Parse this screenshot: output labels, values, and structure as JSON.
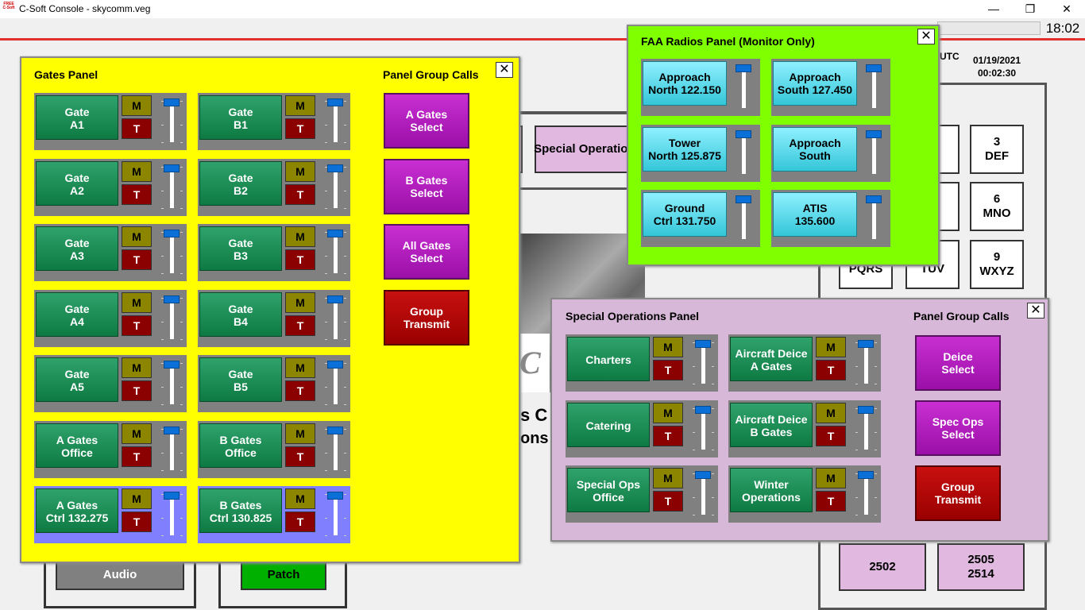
{
  "window": {
    "title": "C-Soft Console - skycomm.veg",
    "icon_text": "FREE C-Soft",
    "minimize": "—",
    "maximize": "❐",
    "close": "✕"
  },
  "clock": "18:02",
  "utc": {
    "label": "UTC",
    "date": "01/19/2021",
    "time": "00:02:30"
  },
  "background": {
    "special_operations": "Special Operations",
    "keypad": [
      {
        "label": "3\nDEF"
      },
      {
        "label": "6\nMNO"
      },
      {
        "label": "9\nWXYZ"
      },
      {
        "label": "PQRS"
      },
      {
        "label": "TUV"
      }
    ],
    "bottom_buttons": [
      {
        "label": "2502"
      },
      {
        "label": "2505\n2514"
      }
    ],
    "audio": "Audio",
    "patch": "Patch",
    "partial_c": "C",
    "partial_s": "s C",
    "partial_ons": "ons"
  },
  "gates_panel": {
    "title": "Gates Panel",
    "group_title": "Panel Group Calls",
    "units": [
      [
        "Gate\nA1",
        "Gate\nB1"
      ],
      [
        "Gate\nA2",
        "Gate\nB2"
      ],
      [
        "Gate\nA3",
        "Gate\nB3"
      ],
      [
        "Gate\nA4",
        "Gate\nB4"
      ],
      [
        "Gate\nA5",
        "Gate\nB5"
      ],
      [
        "A Gates\nOffice",
        "B Gates\nOffice"
      ],
      [
        "A Gates\nCtrl 132.275",
        "B Gates\nCtrl 130.825"
      ]
    ],
    "group_buttons": [
      "A Gates\nSelect",
      "B Gates\nSelect",
      "All Gates\nSelect",
      "Group\nTransmit"
    ],
    "m_label": "M",
    "t_label": "T"
  },
  "faa_panel": {
    "title": "FAA Radios Panel (Monitor Only)",
    "units": [
      [
        "Approach\nNorth 122.150",
        "Approach\nSouth 127.450"
      ],
      [
        "Tower\nNorth 125.875",
        "Approach\nSouth"
      ],
      [
        "Ground\nCtrl 131.750",
        "ATIS\n135.600"
      ]
    ]
  },
  "special_panel": {
    "title": "Special Operations Panel",
    "group_title": "Panel Group Calls",
    "units": [
      [
        "Charters",
        "Aircraft Deice\nA Gates"
      ],
      [
        "Catering",
        "Aircraft Deice\nB Gates"
      ],
      [
        "Special Ops\nOffice",
        "Winter\nOperations"
      ]
    ],
    "group_buttons": [
      "Deice\nSelect",
      "Spec Ops\nSelect",
      "Group\nTransmit"
    ]
  },
  "colors": {
    "gates_bg": "#ffff00",
    "faa_bg": "#80ff00",
    "special_bg": "#d8b8d8",
    "ctrl_unit_bg": "#8080ff"
  }
}
